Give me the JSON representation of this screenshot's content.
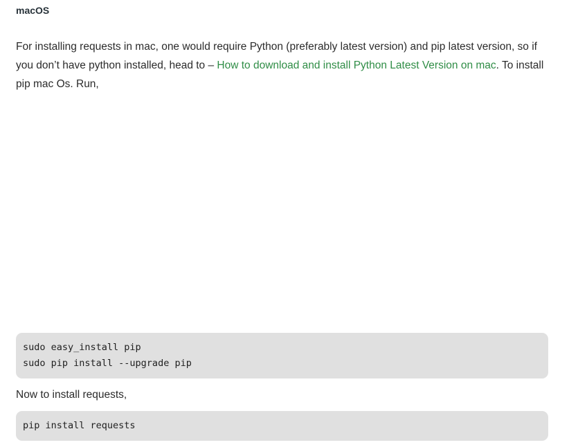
{
  "heading": "macOS",
  "intro": {
    "before_link": "For installing requests in mac, one would require Python (preferably latest version) and pip latest version, so if you don’t have python installed, head to – ",
    "link_text": "How to download and install Python Latest Version on mac",
    "after_link": ". To install pip mac Os. Run,"
  },
  "code_block_1": {
    "lines": [
      "sudo easy_install pip",
      "sudo pip install --upgrade pip"
    ]
  },
  "paragraph_2": "Now to install requests,",
  "code_block_2": {
    "lines": [
      "pip install requests"
    ]
  },
  "colors": {
    "link": "#2f8d46",
    "code_background": "#e0e0e0",
    "text": "#2b2b2b"
  }
}
